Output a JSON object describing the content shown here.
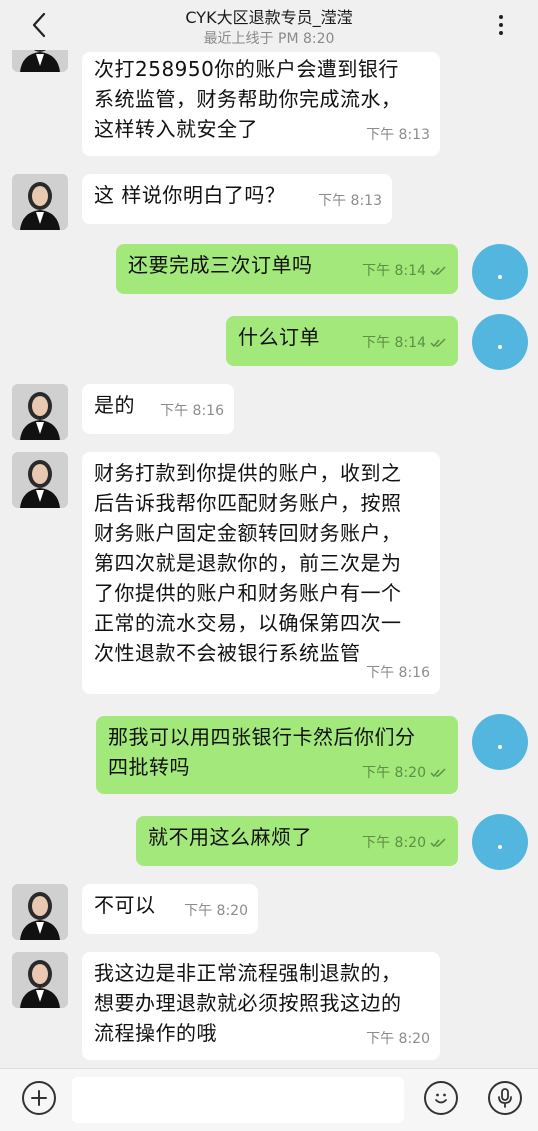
{
  "header": {
    "title": "CYK大区退款专员_滢滢",
    "status": "最近上线于 PM 8:20"
  },
  "messages": [
    {
      "side": "in",
      "text": "次打258950你的账户会遭到银行\n系统监管，财务帮助你完成流水，\n这样转入就安全了",
      "time": "下午  8:13"
    },
    {
      "side": "in",
      "text": "这 样说你明白了吗？",
      "time": "下午  8:13"
    },
    {
      "side": "out",
      "text": "还要完成三次订单吗",
      "time": "下午  8:14"
    },
    {
      "side": "out",
      "text": "什么订单",
      "time": "下午  8:14"
    },
    {
      "side": "in",
      "text": "是的",
      "time": "下午  8:16"
    },
    {
      "side": "in",
      "text": "财务打款到你提供的账户，收到之\n后告诉我帮你匹配财务账户，按照\n财务账户固定金额转回财务账户，\n第四次就是退款你的，前三次是为\n了你提供的账户和财务账户有一个\n正常的流水交易，以确保第四次一\n次性退款不会被银行系统监管",
      "time": "下午  8:16"
    },
    {
      "side": "out",
      "text": "那我可以用四张银行卡然后你们分\n四批转吗",
      "time": "下午  8:20"
    },
    {
      "side": "out",
      "text": "就不用这么麻烦了",
      "time": "下午  8:20"
    },
    {
      "side": "in",
      "text": "不可以",
      "time": "下午  8:20"
    },
    {
      "side": "in",
      "text": "我这边是非正常流程强制退款的，\n想要办理退款就必须按照我这边的\n流程操作的哦",
      "time": "下午  8:20"
    }
  ],
  "input": {
    "placeholder": ""
  },
  "icons": {
    "back": "chevron-left-icon",
    "more": "more-vertical-icon",
    "plus": "plus-icon",
    "emoji": "emoji-icon",
    "mic": "microphone-icon",
    "read": "double-check-icon"
  },
  "colors": {
    "outgoing_bubble": "#a3e87a",
    "incoming_bubble": "#ffffff",
    "my_avatar": "#52b6de",
    "background": "#f0f0f0"
  }
}
